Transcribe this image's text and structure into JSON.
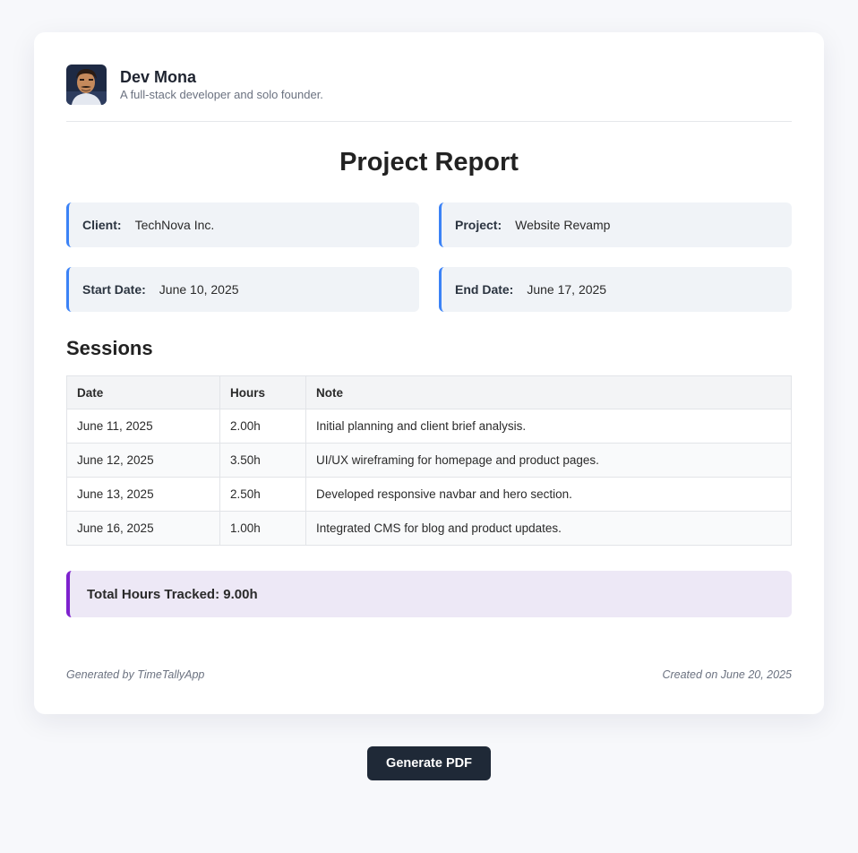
{
  "profile": {
    "name": "Dev Mona",
    "bio": "A full-stack developer and solo founder."
  },
  "report": {
    "title": "Project Report",
    "client_label": "Client:",
    "client": "TechNova Inc.",
    "project_label": "Project:",
    "project": "Website Revamp",
    "start_label": "Start Date:",
    "start_date": "June 10, 2025",
    "end_label": "End Date:",
    "end_date": "June 17, 2025"
  },
  "sessions": {
    "heading": "Sessions",
    "columns": [
      "Date",
      "Hours",
      "Note"
    ],
    "rows": [
      [
        "June 11, 2025",
        "2.00h",
        "Initial planning and client brief analysis."
      ],
      [
        "June 12, 2025",
        "3.50h",
        "UI/UX wireframing for homepage and product pages."
      ],
      [
        "June 13, 2025",
        "2.50h",
        "Developed responsive navbar and hero section."
      ],
      [
        "June 16, 2025",
        "1.00h",
        "Integrated CMS for blog and product updates."
      ]
    ]
  },
  "total": {
    "text": "Total Hours Tracked: 9.00h"
  },
  "footer": {
    "generated": "Generated by TimeTallyApp",
    "created": "Created on June 20, 2025"
  },
  "actions": {
    "generate_pdf": "Generate PDF"
  },
  "colors": {
    "info_accent": "#3b82f6",
    "total_accent": "#7e22ce",
    "button_bg": "#1f2937"
  }
}
